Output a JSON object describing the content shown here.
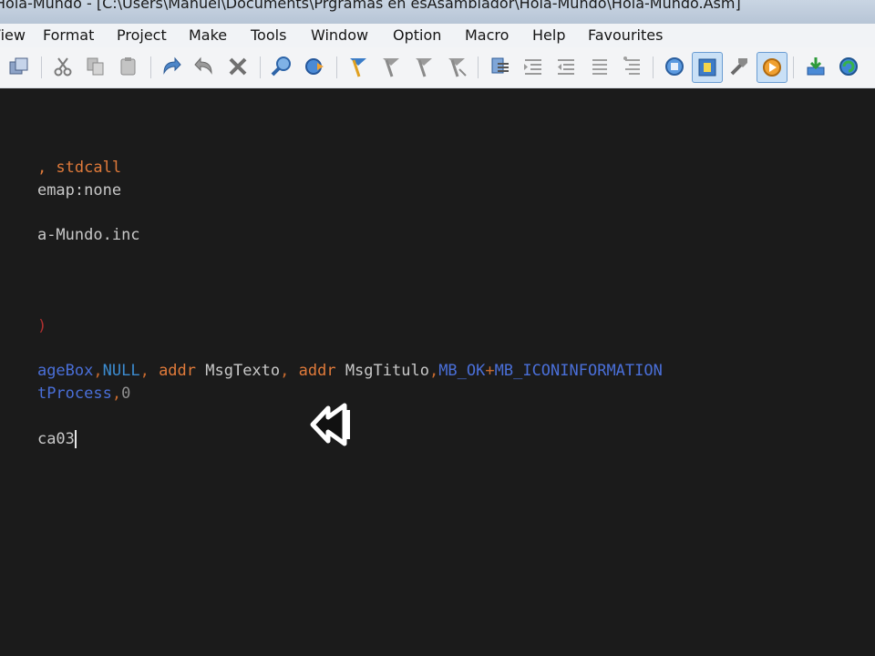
{
  "window": {
    "title": "Hola-Mundo - [C:\\Users\\Manuel\\Documents\\Prgramas en esAsamblador\\Hola-Mundo\\Hola-Mundo.Asm]"
  },
  "menu": {
    "items": [
      "View",
      "Format",
      "Project",
      "Make",
      "Tools",
      "Window",
      "Option",
      "Macro",
      "Help",
      "Favourites"
    ]
  },
  "toolbar": {
    "icons": [
      "windows-icon",
      "cut-icon",
      "copy-icon",
      "paste-icon",
      "undo-icon",
      "redo-icon",
      "delete-icon",
      "find-icon",
      "find-next-icon",
      "bookmark-toggle-icon",
      "bookmark-next-icon",
      "bookmark-prev-icon",
      "bookmark-clear-icon",
      "block-icon",
      "indent-icon",
      "outdent-icon",
      "comment-icon",
      "uncomment-icon",
      "assemble-icon",
      "build-icon",
      "go-icon",
      "run-icon",
      "download-icon",
      "refresh-icon"
    ]
  },
  "editor": {
    "colors": {
      "background": "#1b1b1b",
      "default": "#c8c8c8",
      "keyword": "#e07a3a",
      "api": "#4a6fd8",
      "constant": "#3c8cd0"
    },
    "lines": {
      "l1": {
        "a": ", stdcall"
      },
      "l2": {
        "a": "emap",
        "b": ":none"
      },
      "l4": {
        "a": "a-Mundo.inc"
      },
      "l6": {
        "a": ")"
      },
      "l8": {
        "a": "ageBox",
        "b": ",",
        "c": "NULL",
        "d": ", ",
        "e": "addr",
        "f": " MsgTexto",
        "g": ", ",
        "h": "addr",
        "i": " MsgTitulo",
        "j": ",",
        "k": "MB_OK",
        "l": "+",
        "m": "MB_ICONINFORMATION"
      },
      "l9": {
        "a": "tProcess",
        "b": ",",
        "c": "0"
      },
      "l11": {
        "a": "ca03"
      }
    }
  }
}
